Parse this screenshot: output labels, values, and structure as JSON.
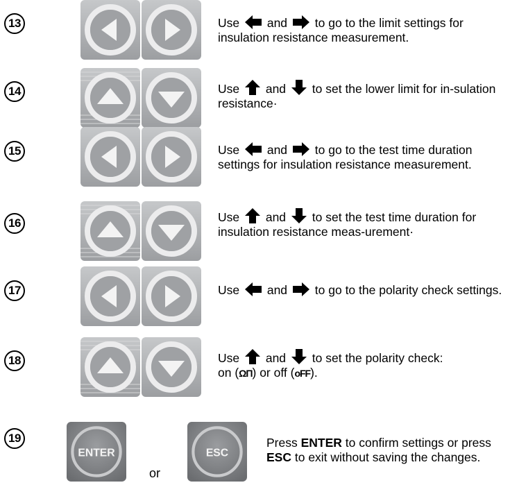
{
  "steps": [
    {
      "number": "13",
      "keys": "left-right",
      "pre": "Use",
      "mid": "and",
      "post": "to go to the limit settings for insulation resistance measurement."
    },
    {
      "number": "14",
      "keys": "up-down",
      "pre": "Use",
      "mid": "and",
      "post": "to set the lower limit for in-sulation resistance·"
    },
    {
      "number": "15",
      "keys": "left-right",
      "pre": "Use",
      "mid": "and",
      "post": "to go to the test time duration settings for insulation resistance measurement."
    },
    {
      "number": "16",
      "keys": "up-down",
      "pre": "Use",
      "mid": "and",
      "post": "to set the test time duration for insulation resistance meas-urement·"
    },
    {
      "number": "17",
      "keys": "left-right",
      "pre": "Use",
      "mid": "and",
      "post": "to go to the polarity check settings."
    },
    {
      "number": "18",
      "keys": "up-down",
      "pre": "Use",
      "mid": "and",
      "post": "to set the polarity check:",
      "line2_pre": "on (",
      "on_symbol": "ΩΠ",
      "line2_mid": ") or off (",
      "off_symbol": "oFF",
      "line2_post": ")."
    },
    {
      "number": "19",
      "enter_key": "ENTER",
      "esc_key": "ESC",
      "or": "or",
      "text1": "Press",
      "enter_word": "ENTER",
      "text2": "to confirm settings or press",
      "esc_word": "ESC",
      "text3": "to exit without saving the changes."
    }
  ],
  "icons": {
    "left": "arrow-left-icon",
    "right": "arrow-right-icon",
    "up": "arrow-up-icon",
    "down": "arrow-down-icon"
  },
  "colors": {
    "key_bg": "#aeb0b3",
    "key_ring": "#e6e7e8",
    "key_arrow": "#f2f2f2",
    "enter_bg": "#7f8184",
    "esc_bg": "#6f7174"
  }
}
